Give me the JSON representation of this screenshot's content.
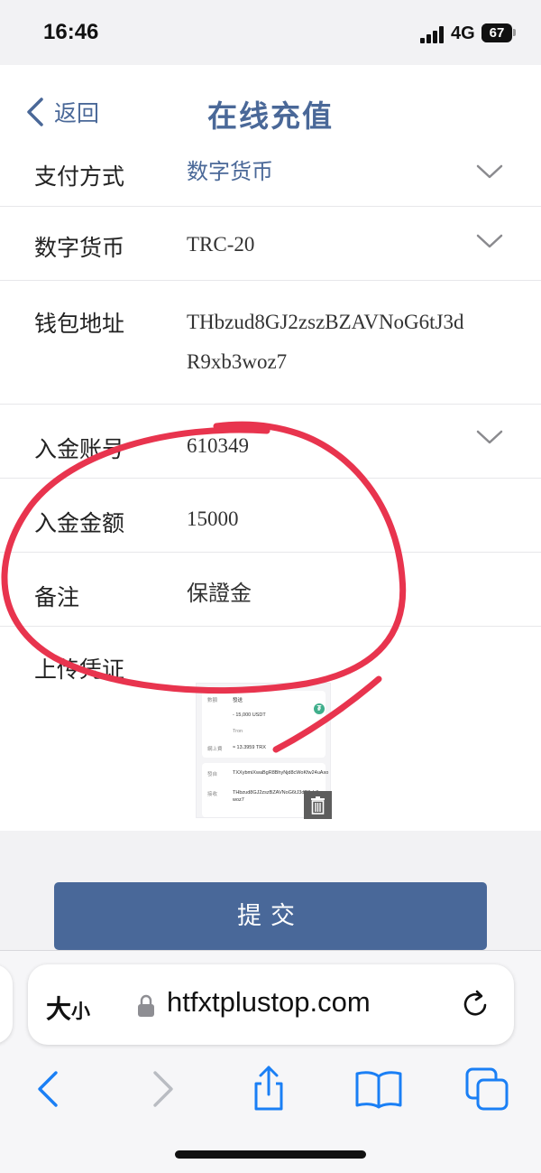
{
  "status_bar": {
    "time": "16:46",
    "network": "4G",
    "battery": "67",
    "battery_level": 0.67
  },
  "header": {
    "back_label": "返回",
    "title": "在线充值"
  },
  "form": {
    "rows": [
      {
        "label": "支付方式",
        "value": "数字货币",
        "has_dropdown": true
      },
      {
        "label": "数字货币",
        "value": "TRC-20",
        "has_dropdown": true
      },
      {
        "label": "钱包地址",
        "value_line1": "THbzud8GJ2zszBZAVNoG6tJ3d",
        "value_line2": "R9xb3woz7",
        "has_dropdown": false
      },
      {
        "label": "入金账号",
        "value": "610349",
        "has_dropdown": true
      },
      {
        "label": "入金金额",
        "value": "15000",
        "has_dropdown": false
      },
      {
        "label": "备注",
        "value": "保證金",
        "has_dropdown": false
      },
      {
        "label": "上传凭证"
      }
    ]
  },
  "upload_thumbnail": {
    "row1_label": "數額",
    "row1_value": "發送",
    "amount": "- 15,000 USDT",
    "placeholder": "Tron",
    "fee_label": "網上費",
    "fee": "≈ 13.3959 TRX",
    "from_label": "發自",
    "from_address": "TXXybmiXwaBgR8BhyNjd8cWoKfw24uAxo",
    "to_label": "接收",
    "to_address_line1": "THbzud8GJ2zszBZAVNoG6tJ3dR9xb3",
    "to_address_line2": "woz7"
  },
  "actions": {
    "submit_label": "提交"
  },
  "browser": {
    "text_size_big": "大",
    "text_size_small": "小",
    "url": "htfxtplustop.com"
  },
  "colors": {
    "accent": "#4a6898",
    "submit": "#496899",
    "annotation": "#e8344e",
    "ios_blue": "#1a7ff5"
  }
}
